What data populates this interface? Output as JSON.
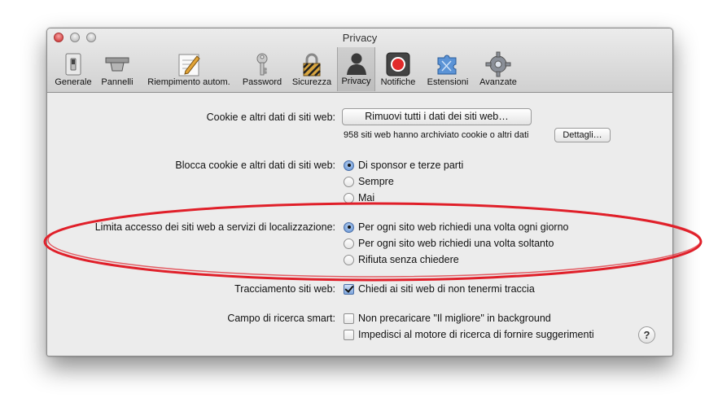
{
  "window": {
    "title": "Privacy"
  },
  "toolbar": {
    "items": [
      {
        "label": "Generale",
        "icon": "switch-icon"
      },
      {
        "label": "Pannelli",
        "icon": "tabs-icon"
      },
      {
        "label": "Riempimento autom.",
        "icon": "autofill-pencil-icon"
      },
      {
        "label": "Password",
        "icon": "key-icon"
      },
      {
        "label": "Sicurezza",
        "icon": "padlock-icon"
      },
      {
        "label": "Privacy",
        "icon": "person-silhouette-icon"
      },
      {
        "label": "Notifiche",
        "icon": "notification-record-icon"
      },
      {
        "label": "Estensioni",
        "icon": "puzzle-piece-icon"
      },
      {
        "label": "Avanzate",
        "icon": "gear-icon"
      }
    ],
    "active": "Privacy"
  },
  "cookies": {
    "label": "Cookie e altri dati di siti web:",
    "remove_button": "Rimuovi tutti i dati dei siti web…",
    "info": "958 siti web hanno archiviato cookie o altri dati",
    "details_button": "Dettagli…"
  },
  "block_cookies": {
    "label": "Blocca cookie e altri dati di siti web:",
    "options": [
      "Di sponsor e terze parti",
      "Sempre",
      "Mai"
    ],
    "selected": 0
  },
  "location": {
    "label": "Limita accesso dei siti web a servizi di localizzazione:",
    "options": [
      "Per ogni sito web richiedi una volta ogni giorno",
      "Per ogni sito web richiedi una volta soltanto",
      "Rifiuta senza chiedere"
    ],
    "selected": 0
  },
  "tracking": {
    "label": "Tracciamento siti web:",
    "checkbox": "Chiedi ai siti web di non tenermi traccia",
    "checked": true
  },
  "smart_search": {
    "label": "Campo di ricerca smart:",
    "options": [
      {
        "text": "Non precaricare \"Il migliore\" in background",
        "checked": false
      },
      {
        "text": "Impedisci al motore di ricerca di fornire suggerimenti",
        "checked": false
      }
    ],
    "help": "?"
  },
  "colors": {
    "highlight_oval": "#e0202a",
    "accent": "#6f9bd8"
  }
}
